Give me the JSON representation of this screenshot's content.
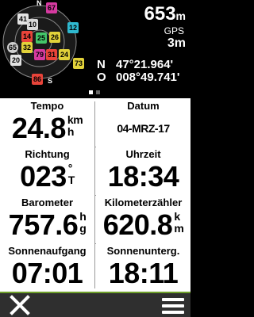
{
  "satellite_panel": {
    "satellites": [
      {
        "id": "67",
        "color": "#d63aa0",
        "shape": "square"
      },
      {
        "id": "41",
        "color": "#e3e3e3",
        "shape": "square"
      },
      {
        "id": "10",
        "color": "#d8d8d8",
        "shape": "square"
      },
      {
        "id": "14",
        "color": "#e8443a",
        "shape": "square"
      },
      {
        "id": "25",
        "color": "#44c66a",
        "shape": "square"
      },
      {
        "id": "26",
        "color": "#e2d23a",
        "shape": "square"
      },
      {
        "id": "12",
        "color": "#2fb9d0",
        "shape": "square"
      },
      {
        "id": "65",
        "color": "#cfcfcf",
        "shape": "round"
      },
      {
        "id": "32",
        "color": "#e2d23a",
        "shape": "square"
      },
      {
        "id": "79",
        "color": "#d63aa0",
        "shape": "square"
      },
      {
        "id": "31",
        "color": "#e8443a",
        "shape": "square"
      },
      {
        "id": "24",
        "color": "#e2d23a",
        "shape": "square"
      },
      {
        "id": "20",
        "color": "#e3e3e3",
        "shape": "square"
      },
      {
        "id": "73",
        "color": "#e2d23a",
        "shape": "square"
      },
      {
        "id": "86",
        "color": "#e8443a",
        "shape": "square"
      }
    ],
    "compass_labels": {
      "north": "N",
      "south": "S"
    },
    "elevation_value": "653",
    "elevation_unit": "m",
    "gps_label": "GPS",
    "accuracy": "3m",
    "latitude": {
      "hemisphere": "N",
      "value": "47°21.964'"
    },
    "longitude": {
      "hemisphere": "O",
      "value": "008°49.741'"
    }
  },
  "page_indicator": {
    "pages": 2,
    "active": 0
  },
  "fields": [
    {
      "label": "Tempo",
      "value": "24.8",
      "unit_top": "km",
      "unit_bottom": "h"
    },
    {
      "label": "Datum",
      "value": "04-MRZ-17"
    },
    {
      "label": "Richtung",
      "value": "023",
      "unit_top": "°",
      "unit_bottom": "T"
    },
    {
      "label": "Uhrzeit",
      "value": "18:34"
    },
    {
      "label": "Barometer",
      "value": "757.6",
      "unit_top": "h",
      "unit_bottom": "g"
    },
    {
      "label": "Kilometerzähler",
      "value": "620.8",
      "unit_top": "k",
      "unit_bottom": "m"
    },
    {
      "label": "Sonnenaufgang",
      "value": "07:01"
    },
    {
      "label": "Sonnenunterg.",
      "value": "18:11"
    }
  ],
  "bottom_bar": {
    "close_icon": "close-x-icon",
    "menu_icon": "hamburger-menu-icon",
    "accent_color": "#6ea02a"
  }
}
